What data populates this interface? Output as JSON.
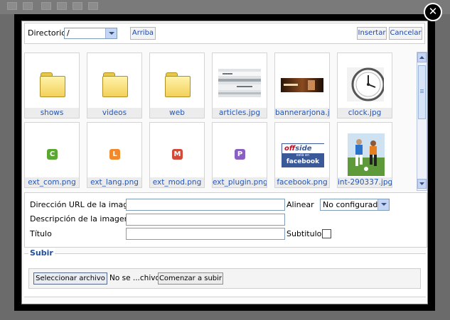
{
  "close_glyph": "✕",
  "toolbar": {
    "directory_label": "Directorio",
    "directory_value": "/",
    "up_label": "Arriba",
    "insert_label": "Insertar",
    "cancel_label": "Cancelar"
  },
  "gallery": {
    "items": [
      {
        "name": "shows",
        "kind": "folder"
      },
      {
        "name": "videos",
        "kind": "folder"
      },
      {
        "name": "web",
        "kind": "folder"
      },
      {
        "name": "articles.jpg",
        "kind": "image"
      },
      {
        "name": "bannerarjona.jpg",
        "kind": "image"
      },
      {
        "name": "clock.jpg",
        "kind": "image"
      },
      {
        "name": "ext_com.png",
        "kind": "badge",
        "letter": "C",
        "color": "#5aa832"
      },
      {
        "name": "ext_lang.png",
        "kind": "badge",
        "letter": "L",
        "color": "#f08a2c"
      },
      {
        "name": "ext_mod.png",
        "kind": "badge",
        "letter": "M",
        "color": "#d14b3b"
      },
      {
        "name": "ext_plugin.png",
        "kind": "badge",
        "letter": "P",
        "color": "#8a5fc2"
      },
      {
        "name": "facebook.png",
        "kind": "image"
      },
      {
        "name": "int-290337.jpg",
        "kind": "image"
      }
    ]
  },
  "facebook_thumb": {
    "top_left": "off",
    "top_right": "side",
    "middle": "está en",
    "bottom": "facebook"
  },
  "form": {
    "url_label": "Dirección URL de la imagen",
    "url_value": "",
    "align_label": "Alinear",
    "align_value": "No configurado",
    "desc_label": "Descripción de la imagen",
    "desc_value": "",
    "title_label": "Título",
    "title_value": "",
    "caption_label": "Subtitulo",
    "caption_checked": false
  },
  "upload": {
    "legend": "Subir",
    "select_file_label": "Seleccionar archivo",
    "no_file_text": "No se ...chivo",
    "start_label": "Comenzar a subir"
  }
}
